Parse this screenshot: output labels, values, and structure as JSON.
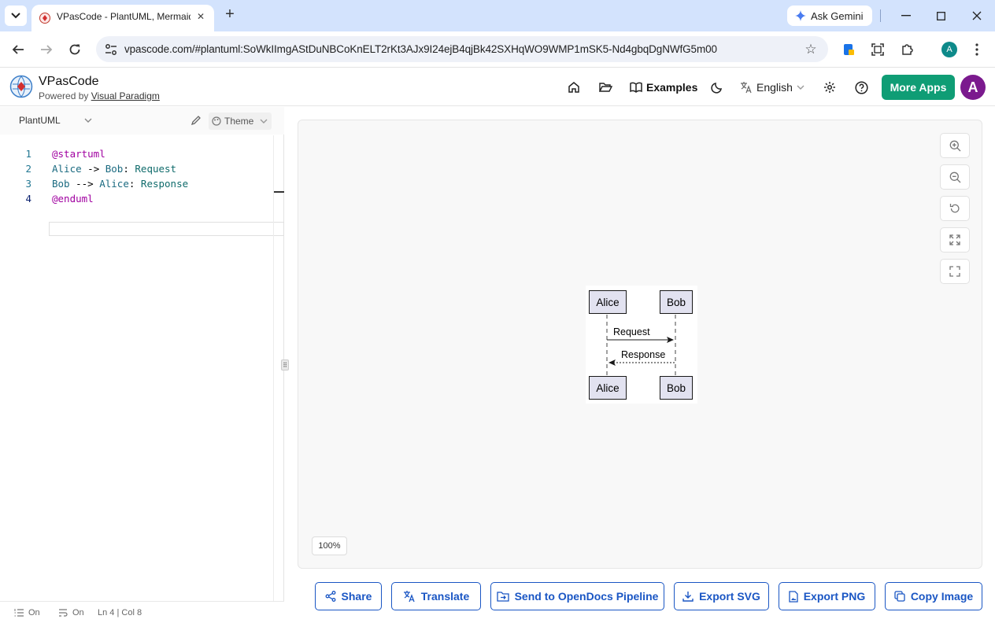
{
  "browser": {
    "tab_title": "VPasCode - PlantUML, Mermaid",
    "ask_gemini_label": "Ask Gemini",
    "url": "vpascode.com/#plantuml:SoWkIImgAStDuNBCoKnELT2rKt3AJx9I24ejB4qjBk42SXHqWO9WMP1mSK5-Nd4gbqDgNWfG5m00",
    "profile_initial": "A"
  },
  "header": {
    "brand_name": "VPasCode",
    "powered_by_prefix": "Powered by ",
    "powered_by_link": "Visual Paradigm",
    "examples_label": "Examples",
    "language_label": "English",
    "more_apps_label": "More Apps",
    "avatar_initial": "A"
  },
  "editor": {
    "language": "PlantUML",
    "theme_label": "Theme",
    "line_numbers": [
      "1",
      "2",
      "3",
      "4"
    ],
    "lines": {
      "l1": "@startuml",
      "l2_a": "Alice",
      "l2_b": " -> ",
      "l2_c": "Bob",
      "l2_d": ": ",
      "l2_e": "Request",
      "l3_a": "Bob",
      "l3_b": " --> ",
      "l3_c": "Alice",
      "l3_d": ": ",
      "l3_e": "Response",
      "l4": "@enduml"
    },
    "status": {
      "wrap_label": "On",
      "minimap_label": "On",
      "cursor_position": "Ln 4 | Col 8"
    }
  },
  "canvas": {
    "zoom_level": "100%",
    "diagram": {
      "participants": [
        "Alice",
        "Bob"
      ],
      "messages": [
        "Request",
        "Response"
      ]
    }
  },
  "actions": {
    "share": "Share",
    "translate": "Translate",
    "send_pipeline": "Send to OpenDocs Pipeline",
    "export_svg": "Export SVG",
    "export_png": "Export PNG",
    "copy_image": "Copy Image"
  },
  "colors": {
    "accent": "#1a56c4",
    "more_apps_bg": "#0f9d75",
    "avatar_bg": "#7b1a8e",
    "tabstrip_bg": "#d3e3fd",
    "participant_fill": "#e2e2f0"
  }
}
